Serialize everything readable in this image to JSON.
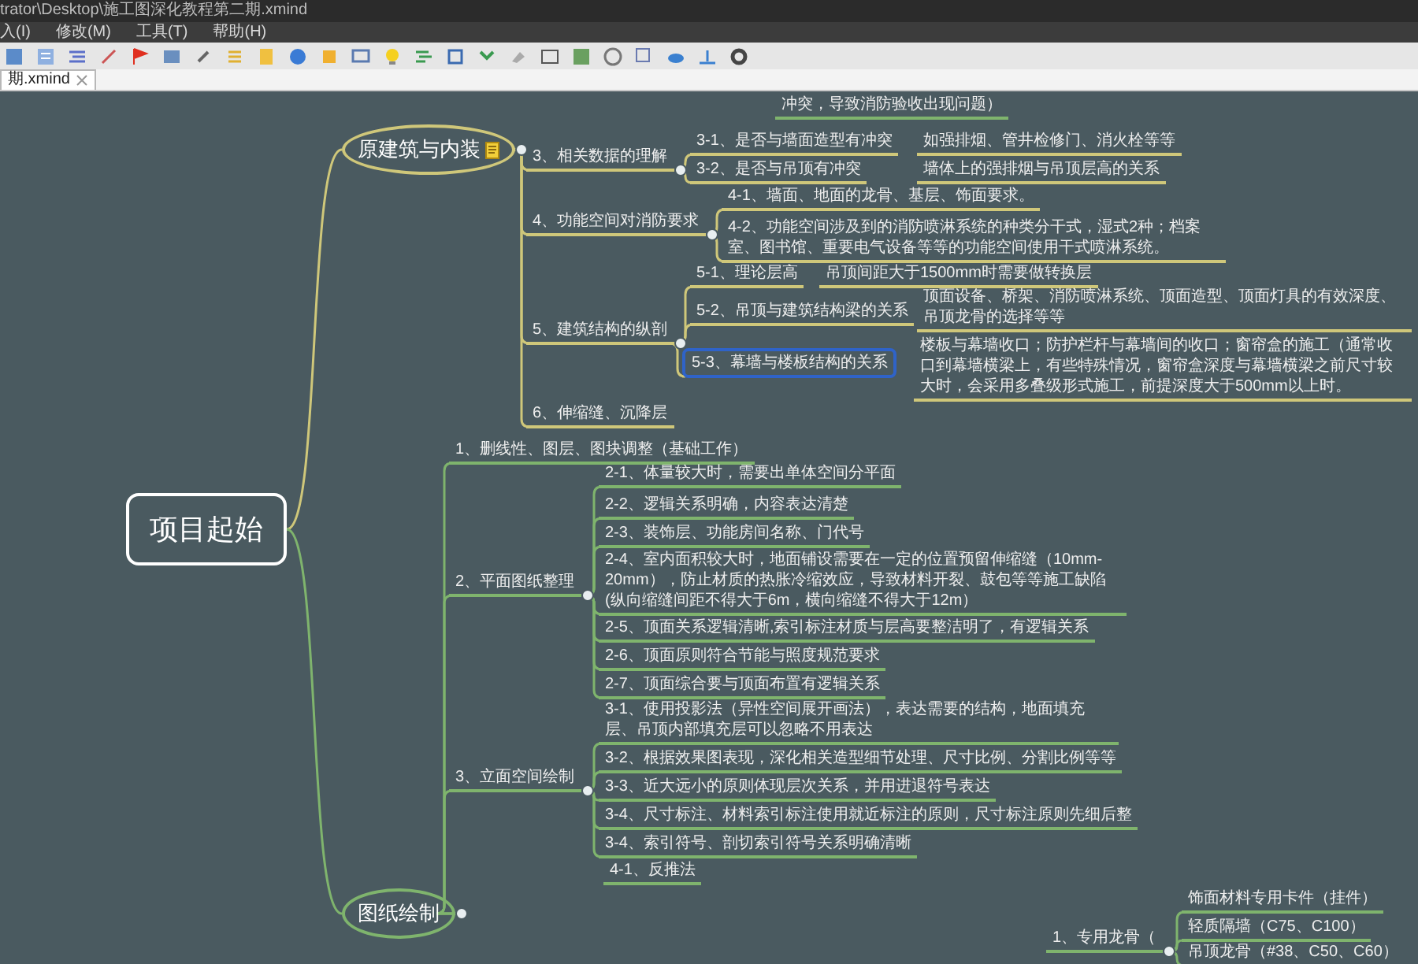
{
  "window": {
    "title": "trator\\Desktop\\施工图深化教程第二期.xmind"
  },
  "menu": [
    "入(I)",
    "修改(M)",
    "工具(T)",
    "帮助(H)"
  ],
  "tabs": [
    {
      "label": "期.xmind",
      "selected": true
    }
  ],
  "map": {
    "central": {
      "label": "项目起始",
      "selected": false,
      "children": [
        {
          "label": "原建筑与内装",
          "selected": false,
          "color": "#cfc77a",
          "has_note": true,
          "children": [
            {
              "label": "3、相关数据的理解",
              "selected": false,
              "children": [
                {
                  "label": "3-1、是否与墙面造型有冲突",
                  "selected": false,
                  "note": "如强排烟、管井检修门、消火栓等等"
                },
                {
                  "label": "3-2、是否与吊顶有冲突",
                  "selected": false,
                  "note": "墙体上的强排烟与吊顶层高的关系"
                }
              ]
            },
            {
              "label": "4、功能空间对消防要求",
              "selected": false,
              "children": [
                {
                  "label": "4-1、墙面、地面的龙骨、基层、饰面要求。",
                  "selected": false
                },
                {
                  "label": "4-2、功能空间涉及到的消防喷淋系统的种类分干式，湿式2种；档案室、图书馆、重要电气设备等等的功能空间使用干式喷淋系统。",
                  "selected": false
                }
              ]
            },
            {
              "label": "5、建筑结构的纵剖",
              "selected": false,
              "children": [
                {
                  "label": "5-1、理论层高",
                  "selected": false,
                  "note": "吊顶间距大于1500mm时需要做转换层"
                },
                {
                  "label": "5-2、吊顶与建筑结构梁的关系",
                  "selected": false,
                  "note": "顶面设备、桥架、消防喷淋系统、顶面造型、顶面灯具的有效深度、吊顶龙骨的选择等等"
                },
                {
                  "label": "5-3、幕墙与楼板结构的关系",
                  "selected": true,
                  "note": "楼板与幕墙收口；防护栏杆与幕墙间的收口；窗帘盒的施工（通常收口到幕墙横梁上，有些特殊情况，窗帘盒深度与幕墙横梁之前尺寸较大时，会采用多叠级形式施工，前提深度大于500mm以上时。"
                }
              ]
            },
            {
              "label": "6、伸缩缝、沉降层",
              "selected": false
            }
          ]
        },
        {
          "label": "图纸绘制",
          "selected": false,
          "color": "#7fb46d",
          "has_note": false,
          "children": [
            {
              "label": "1、删线性、图层、图块调整（基础工作）",
              "selected": false
            },
            {
              "label": "2、平面图纸整理",
              "selected": false,
              "children": [
                {
                  "label": "2-1、体量较大时，需要出单体空间分平面",
                  "selected": false
                },
                {
                  "label": "2-2、逻辑关系明确，内容表达清楚",
                  "selected": false
                },
                {
                  "label": "2-3、装饰层、功能房间名称、门代号",
                  "selected": false
                },
                {
                  "label": "2-4、室内面积较大时，地面铺设需要在一定的位置预留伸缩缝（10mm-20mm），防止材质的热胀冷缩效应，导致材料开裂、鼓包等等施工缺陷(纵向缩缝间距不得大于6m，横向缩缝不得大于12m）",
                  "selected": false
                },
                {
                  "label": "2-5、顶面关系逻辑清晰,索引标注材质与层高要整洁明了，有逻辑关系",
                  "selected": false
                },
                {
                  "label": "2-6、顶面原则符合节能与照度规范要求",
                  "selected": false
                },
                {
                  "label": "2-7、顶面综合要与顶面布置有逻辑关系",
                  "selected": false
                }
              ]
            },
            {
              "label": "3、立面空间绘制",
              "selected": false,
              "children": [
                {
                  "label": "3-1、使用投影法（异性空间展开画法），表达需要的结构，地面填充层、吊顶内部填充层可以忽略不用表达",
                  "selected": false
                },
                {
                  "label": "3-2、根据效果图表现，深化相关造型细节处理、尺寸比例、分割比例等等",
                  "selected": false
                },
                {
                  "label": "3-3、近大远小的原则体现层次关系，并用进退符号表达",
                  "selected": false
                },
                {
                  "label": "3-4、尺寸标注、材料索引标注使用就近标注的原则，尺寸标注原则先细后整",
                  "selected": false
                },
                {
                  "label": "3-4、索引符号、剖切索引符号关系明确清晰",
                  "selected": false
                }
              ]
            }
          ]
        }
      ]
    },
    "loose": [
      {
        "label": "冲突，导致消防验收出现问题）",
        "selected": false
      },
      {
        "label": "4-1、反推法",
        "selected": false
      },
      {
        "label": "1、专用龙骨（",
        "selected": false,
        "children": [
          {
            "label": "饰面材料专用卡件（挂件）",
            "selected": false
          },
          {
            "label": "轻质隔墙（C75、C100）",
            "selected": false
          },
          {
            "label": "吊顶龙骨（#38、C50、C60）",
            "selected": false
          }
        ]
      }
    ]
  }
}
